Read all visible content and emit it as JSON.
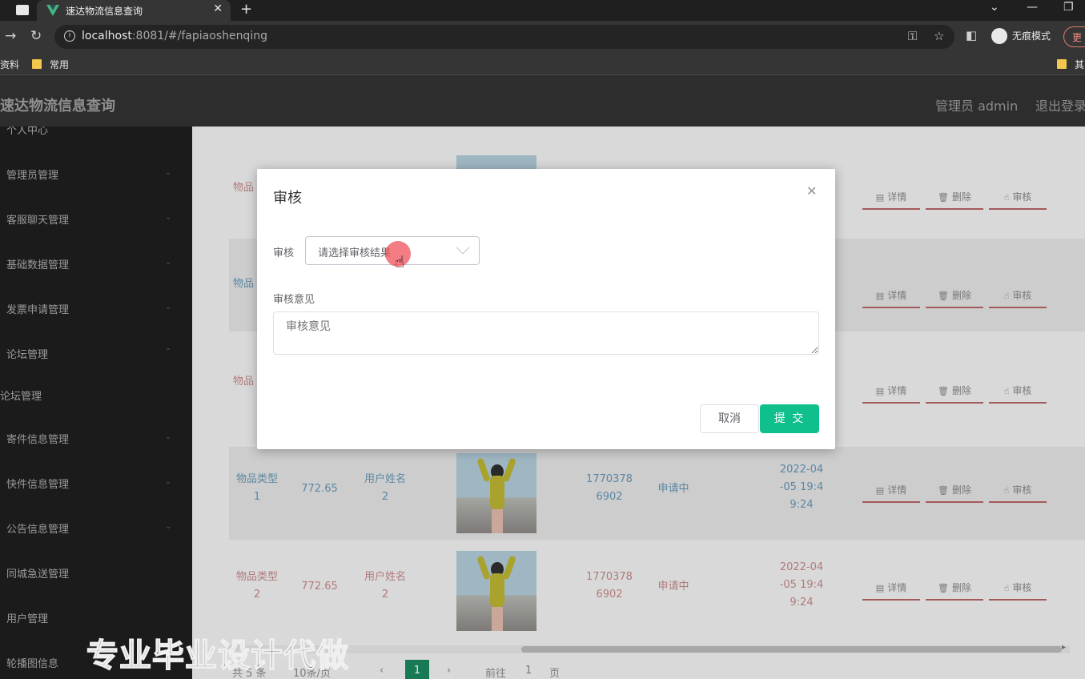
{
  "browser": {
    "tab_title": "速达物流信息查询",
    "url_host": "localhost",
    "url_rest": ":8081/#/fapiaoshenqing",
    "incognito_label": "无痕模式",
    "update_label": "更",
    "bookmarks": [
      "资料",
      "常用",
      "其"
    ]
  },
  "app": {
    "brand": "速达物流信息查询",
    "admin_label": "管理员 admin",
    "logout_label": "退出登录"
  },
  "sidebar": {
    "items": [
      {
        "label": "个人中心"
      },
      {
        "label": "管理员管理"
      },
      {
        "label": "客服聊天管理"
      },
      {
        "label": "基础数据管理"
      },
      {
        "label": "发票申请管理"
      },
      {
        "label": "论坛管理"
      },
      {
        "label": "论坛管理"
      },
      {
        "label": "寄件信息管理"
      },
      {
        "label": "快件信息管理"
      },
      {
        "label": "公告信息管理"
      },
      {
        "label": "同城急送管理"
      },
      {
        "label": "用户管理"
      },
      {
        "label": "轮播图信息"
      }
    ]
  },
  "table": {
    "rows": [
      {
        "type": "物品类型",
        "type_num": "1",
        "amount": "772.65",
        "user": "用户姓名",
        "user_num": "2",
        "phone_a": "1770378",
        "phone_b": "6902",
        "status": "申请中",
        "time_a": "2022-04",
        "time_b": "-05 19:4",
        "time_c": "9:24"
      },
      {
        "type": "物品类型",
        "type_num": "2",
        "amount": "772.65",
        "user": "用户姓名",
        "user_num": "2",
        "phone_a": "1770378",
        "phone_b": "6902",
        "status": "申请中",
        "time_a": "2022-04",
        "time_b": "-05 19:4",
        "time_c": "9:24"
      }
    ],
    "partial_row_labels": [
      "物品",
      "物品",
      "物品"
    ],
    "actions": {
      "detail": "详情",
      "delete": "删除",
      "audit": "审核"
    }
  },
  "pagination": {
    "total": "共 5 条",
    "page_size": "10条/页",
    "current": "1",
    "goto_prefix": "前往",
    "goto_value": "1",
    "goto_suffix": "页"
  },
  "watermark": "专业毕业设计代做",
  "dialog": {
    "title": "审核",
    "field_label": "审核",
    "select_placeholder": "请选择审核结果",
    "opinion_label": "审核意见",
    "opinion_placeholder": "审核意见",
    "cancel_label": "取消",
    "submit_label": "提 交"
  },
  "colors": {
    "primary": "#0fc08c",
    "header_bg": "#2d2d2d",
    "sidebar_bg": "#1b1b1b",
    "click_highlight": "#f0505a"
  }
}
